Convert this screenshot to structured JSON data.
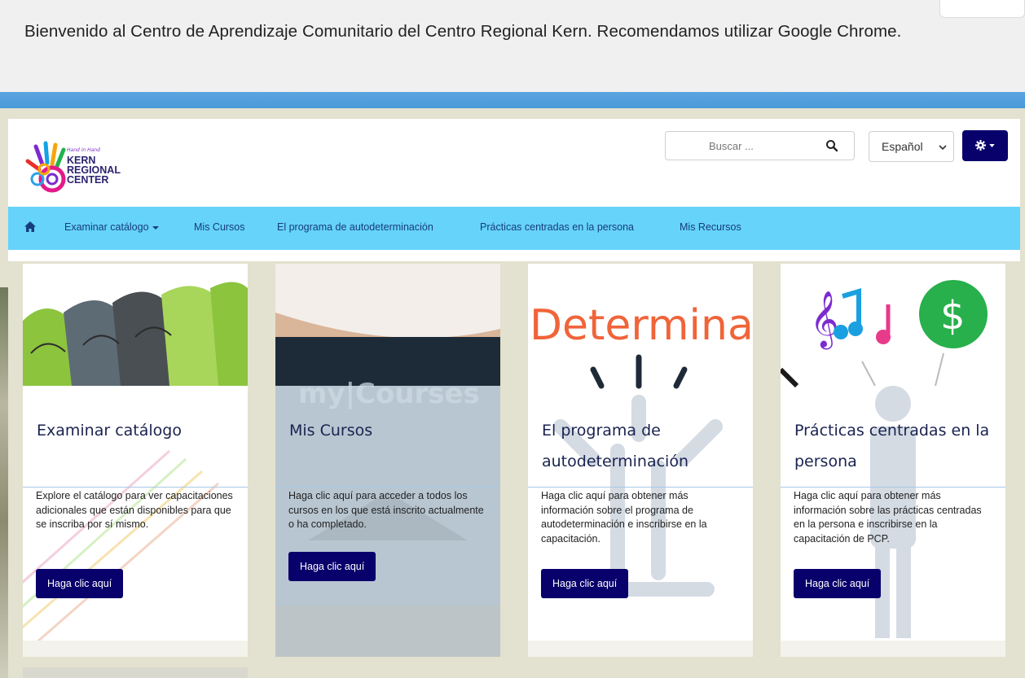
{
  "banner": {
    "welcome": "Bienvenido al Centro de Aprendizaje Comunitario del Centro Regional Kern. Recomendamos utilizar Google Chrome."
  },
  "header": {
    "logo_lines": [
      "KERN",
      "REGIONAL",
      "CENTER"
    ],
    "search_placeholder": "Buscar ...",
    "language": "Español"
  },
  "nav": {
    "items": [
      {
        "label": "Examinar catálogo",
        "dropdown": true
      },
      {
        "label": "Mis Cursos"
      },
      {
        "label": "El programa de autodeterminación"
      },
      {
        "label": "Prácticas centradas en la persona"
      },
      {
        "label": "Mis Recursos"
      }
    ]
  },
  "cards": [
    {
      "title": "Examinar catálogo",
      "description": "Explore el catálogo para ver capacitaciones adicionales que están disponibles para que se inscriba por sí mismo.",
      "button": "Haga clic aquí"
    },
    {
      "title": "Mis Cursos",
      "image_text": "my|Courses",
      "description": "Haga clic aquí para acceder a todos los cursos en los que está inscrito actualmente o ha completado.",
      "button": "Haga clic aquí"
    },
    {
      "title": "El programa de autodeterminación",
      "image_text": "Determina",
      "description": "Haga clic aquí para obtener más información sobre el programa de autodeterminación e inscribirse en la capacitación.",
      "button": "Haga clic aquí"
    },
    {
      "title": "Prácticas centradas en la persona",
      "description": "Haga clic aquí para obtener más información sobre las prácticas centradas en la persona e inscribirse en la capacitación de PCP.",
      "button": "Haga clic aquí"
    }
  ],
  "colors": {
    "brand_navy": "#08006b",
    "nav_blue": "#66d3fa",
    "title_text": "#1a2350"
  }
}
